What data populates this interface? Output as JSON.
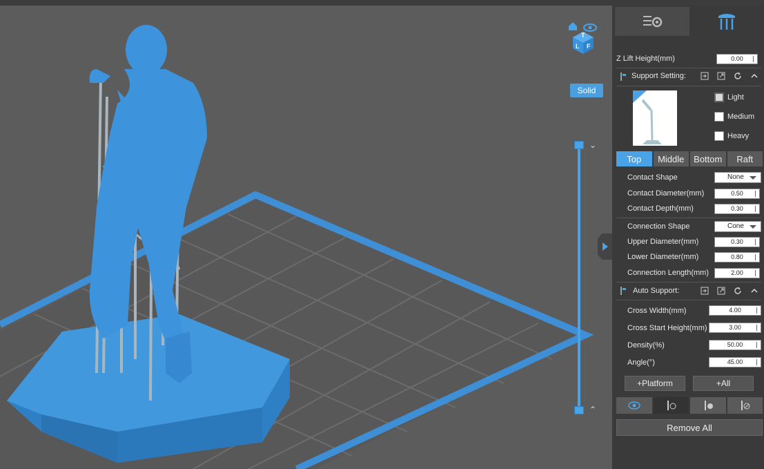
{
  "viewport": {
    "solid_label": "Solid",
    "navcube_faces": [
      "T",
      "L",
      "F"
    ],
    "icons": [
      "home-icon",
      "eye-icon",
      "chevron-down-icon",
      "chevron-up-icon",
      "panel-collapse-arrow-icon"
    ]
  },
  "panel": {
    "tabs": [
      {
        "icon": "settings-list-icon",
        "active": false
      },
      {
        "icon": "support-structure-icon",
        "active": true
      }
    ],
    "z_lift": {
      "label": "Z Lift Height(mm)",
      "value": "0.00"
    },
    "support_setting": {
      "title": "Support Setting:",
      "header_icons": [
        "import-icon",
        "export-icon",
        "refresh-icon",
        "chevron-up-icon"
      ],
      "presets": [
        {
          "label": "Light",
          "checked": true
        },
        {
          "label": "Medium",
          "checked": false
        },
        {
          "label": "Heavy",
          "checked": false
        }
      ],
      "tabs": [
        "Top",
        "Middle",
        "Bottom",
        "Raft"
      ],
      "active_tab": "Top",
      "contact_shape": {
        "label": "Contact Shape",
        "value": "None"
      },
      "contact_diameter": {
        "label": "Contact Diameter(mm)",
        "value": "0.50"
      },
      "contact_depth": {
        "label": "Contact Depth(mm)",
        "value": "0.30"
      },
      "connection_shape": {
        "label": "Connection Shape",
        "value": "Cone"
      },
      "upper_diameter": {
        "label": "Upper Diameter(mm)",
        "value": "0.30"
      },
      "lower_diameter": {
        "label": "Lower Diameter(mm)",
        "value": "0.80"
      },
      "connection_length": {
        "label": "Connection Length(mm)",
        "value": "2.00"
      }
    },
    "auto_support": {
      "title": "Auto Support:",
      "header_icons": [
        "import-icon",
        "export-icon",
        "refresh-icon",
        "chevron-up-icon"
      ],
      "cross_width": {
        "label": "Cross Width(mm)",
        "value": "4.00"
      },
      "cross_start_height": {
        "label": "Cross Start Height(mm)",
        "value": "3.00"
      },
      "density": {
        "label": "Density(%)",
        "value": "50.00"
      },
      "angle": {
        "label": "Angle(°)",
        "value": "45.00"
      },
      "platform_button": "+Platform",
      "all_button": "+All"
    },
    "tool_icons": [
      "eye-icon",
      "support-add-icon",
      "support-remove-icon",
      "support-clear-icon"
    ],
    "remove_all": "Remove All"
  },
  "colors": {
    "accent": "#4aa3e6",
    "model": "#3d8fd6",
    "support": "#a8b4bc",
    "panel_bg": "#3a3a3a",
    "viewport_bg": "#5c5c5c"
  }
}
